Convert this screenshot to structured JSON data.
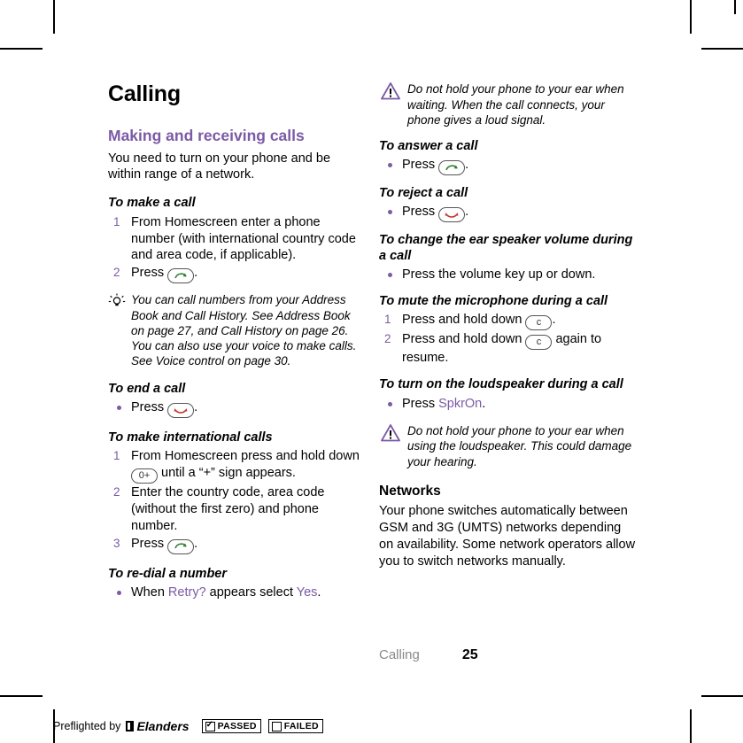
{
  "document": {
    "title": "Calling",
    "footer": {
      "chapter": "Calling",
      "page": "25"
    }
  },
  "left_column": {
    "section_heading": "Making and receiving calls",
    "intro": "You need to turn on your phone and be within range of a network.",
    "tasks": [
      {
        "heading": "To make a call",
        "steps": [
          {
            "num": "1",
            "text": "From Homescreen enter a phone number (with international country code and area code, if applicable)."
          },
          {
            "num": "2",
            "text_before": "Press ",
            "key": "call",
            "text_after": "."
          }
        ]
      }
    ],
    "tip": "You can call numbers from your Address Book and Call History. See  Address Book on page 27, and  Call History  on page 26. You can also use your voice to make calls. See Voice control on page 30.",
    "task_end_call": {
      "heading": "To end a call",
      "bullet_before": "Press ",
      "key": "end",
      "bullet_after": "."
    },
    "task_international": {
      "heading": "To make international calls",
      "steps": [
        {
          "num": "1",
          "text_before": "From Homescreen press and hold down ",
          "key": "0+",
          "text_after": " until a “+” sign appears."
        },
        {
          "num": "2",
          "text": "Enter the country code, area code (without the first zero) and phone number."
        },
        {
          "num": "3",
          "text_before": "Press ",
          "key": "call",
          "text_after": "."
        }
      ]
    },
    "task_redial": {
      "heading": "To re-dial a number",
      "bullet_before": "When ",
      "link1": "Retry?",
      "bullet_mid": " appears select ",
      "link2": "Yes",
      "bullet_after": "."
    }
  },
  "right_column": {
    "warning_top": "Do not hold your phone to your ear when waiting. When the call connects, your phone gives a loud signal.",
    "task_answer": {
      "heading": "To answer a call",
      "bullet_before": "Press ",
      "key": "call",
      "bullet_after": "."
    },
    "task_reject": {
      "heading": "To reject a call",
      "bullet_before": "Press ",
      "key": "end",
      "bullet_after": "."
    },
    "task_ear_volume": {
      "heading": "To change the ear speaker volume during a call",
      "bullet": "Press the volume key up or down."
    },
    "task_mute": {
      "heading": "To mute the microphone during a call",
      "steps": [
        {
          "num": "1",
          "text_before": "Press and hold down ",
          "key": "c",
          "text_after": "."
        },
        {
          "num": "2",
          "text_before": "Press and hold down ",
          "key": "c",
          "text_after": " again to resume."
        }
      ]
    },
    "task_loudspeaker": {
      "heading": "To turn on the loudspeaker during a call",
      "bullet_before": "Press ",
      "link": "SpkrOn",
      "bullet_after": "."
    },
    "warning_bottom": "Do not hold your phone to your ear when using the loudspeaker. This could damage your hearing.",
    "networks": {
      "heading": "Networks",
      "text": "Your phone switches automatically between GSM and 3G (UMTS) networks depending on availability. Some network operators allow you to switch networks manually."
    }
  },
  "preflight_bar": {
    "label": "Preflighted by",
    "brand": "Elanders",
    "passed": "PASSED",
    "failed": "FAILED"
  },
  "colors": {
    "accent": "#7b5aa6",
    "warning_icon": "#7b5aa6",
    "footer_chapter": "#8a8a8a"
  }
}
